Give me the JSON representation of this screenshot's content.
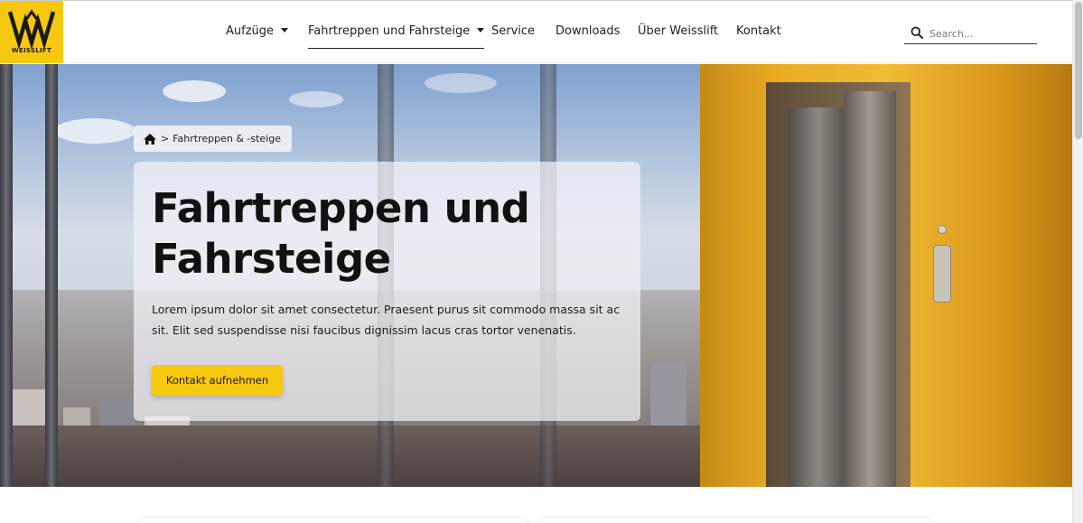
{
  "brand": {
    "logo_text": "WEISSLIFT",
    "accent_color": "#f6c80f"
  },
  "nav": {
    "items": [
      {
        "label": "Aufzüge",
        "has_dropdown": true,
        "active": false
      },
      {
        "label": "Fahrtreppen und Fahrsteige",
        "has_dropdown": true,
        "active": true
      },
      {
        "label": "Service",
        "has_dropdown": false,
        "active": false
      },
      {
        "label": "Downloads",
        "has_dropdown": false,
        "active": false
      },
      {
        "label": "Über Weisslift",
        "has_dropdown": false,
        "active": false
      },
      {
        "label": "Kontakt",
        "has_dropdown": false,
        "active": false
      }
    ]
  },
  "search": {
    "placeholder": "Search...",
    "value": "",
    "icon": "search-icon"
  },
  "breadcrumb": {
    "home_icon": "home-icon",
    "separator": ">",
    "current": "Fahrtreppen & -steige"
  },
  "hero": {
    "title": "Fahrtreppen und Fahrsteige",
    "description": "Lorem ipsum dolor sit amet consectetur. Praesent purus sit commodo massa sit ac sit. Elit sed suspendisse nisi faucibus dignissim lacus cras tortor venenatis.",
    "cta_label": "Kontakt aufnehmen"
  }
}
